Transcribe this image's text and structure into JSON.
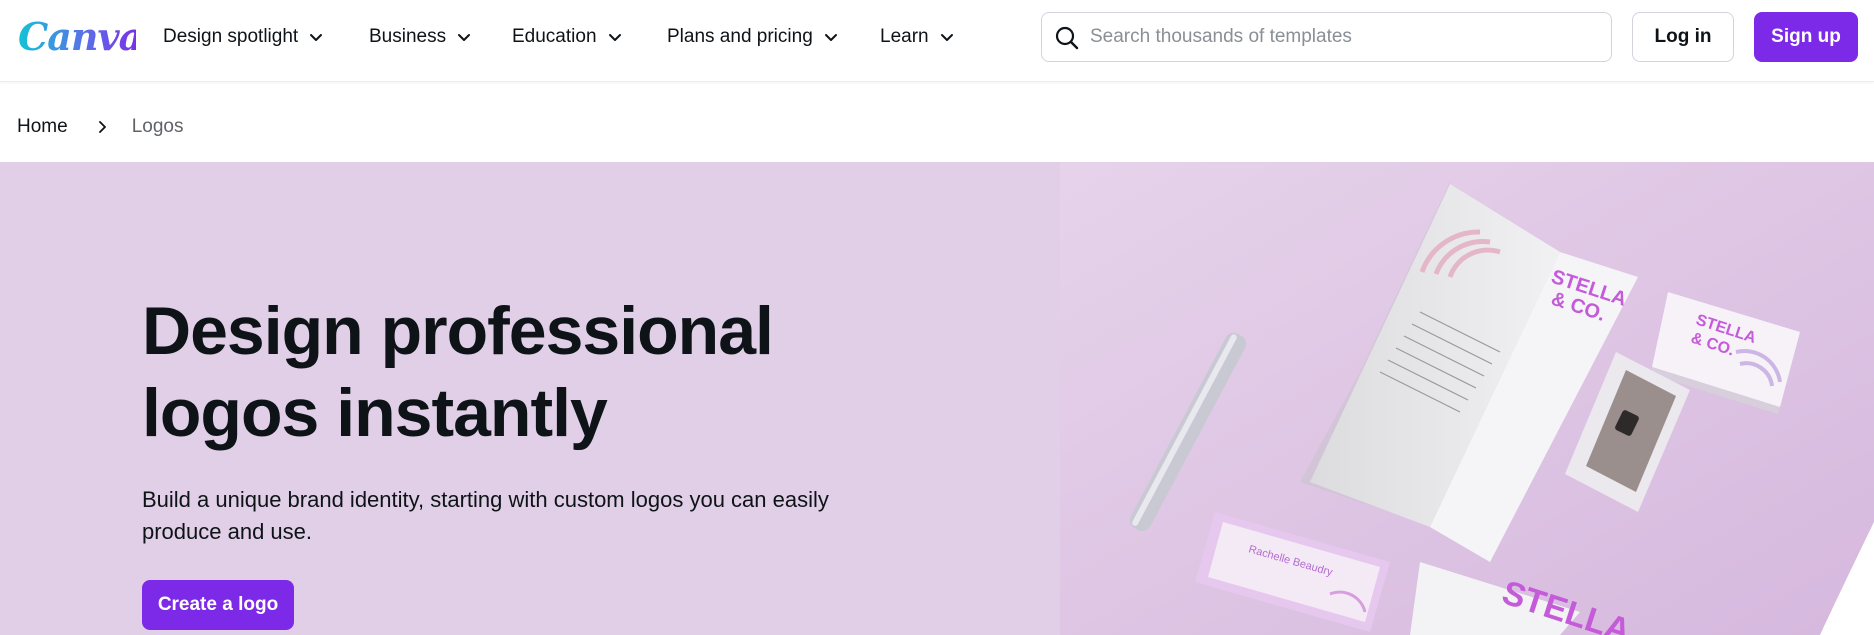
{
  "brand": {
    "name": "Canva"
  },
  "nav": {
    "items": [
      {
        "label": "Design spotlight",
        "icon": "chevron-down-icon"
      },
      {
        "label": "Business",
        "icon": "chevron-down-icon"
      },
      {
        "label": "Education",
        "icon": "chevron-down-icon"
      },
      {
        "label": "Plans and pricing",
        "icon": "chevron-down-icon"
      },
      {
        "label": "Learn",
        "icon": "chevron-down-icon"
      }
    ]
  },
  "search": {
    "placeholder": "Search thousands of templates",
    "value": "",
    "icon": "search-icon"
  },
  "auth": {
    "login_label": "Log in",
    "signup_label": "Sign up"
  },
  "breadcrumb": {
    "home": "Home",
    "current": "Logos",
    "separator_icon": "chevron-right-icon"
  },
  "hero": {
    "title": "Design professional logos instantly",
    "subtitle": "Build a unique brand identity, starting with custom logos you can easily produce and use.",
    "cta_label": "Create a logo",
    "art_brand_text": [
      "STELLA",
      "& CO."
    ],
    "art_card_name": "Rachelle Beaudry"
  },
  "colors": {
    "accent": "#7d2ae8",
    "hero_bg": "#e0cfe6",
    "logo_teal": "#13a6c8",
    "text": "#0e1318"
  }
}
